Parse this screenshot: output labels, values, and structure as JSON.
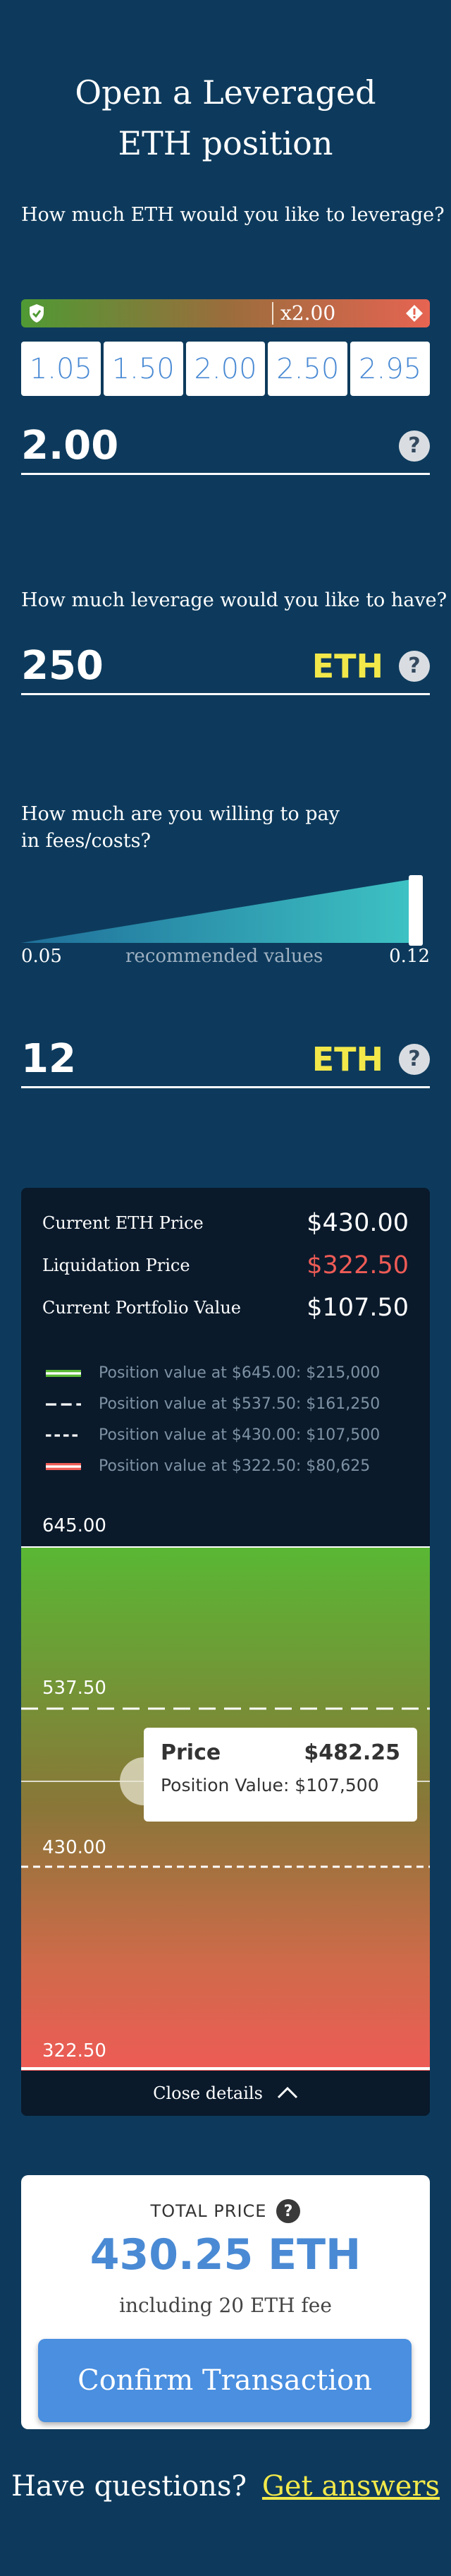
{
  "page": {
    "title_line1": "Open a Leveraged",
    "title_line2": "ETH position"
  },
  "leverage_section": {
    "question": "How much ETH would you like to leverage?",
    "current_multiplier": "x2.00",
    "options": [
      "1.05",
      "1.50",
      "2.00",
      "2.50",
      "2.95"
    ],
    "value": "2.00",
    "help": "?"
  },
  "amount_section": {
    "question": "How much leverage would you like to have?",
    "value": "250",
    "unit": "ETH",
    "help": "?"
  },
  "fees_section": {
    "question_line1": "How much are you willing to pay",
    "question_line2": "in fees/costs?",
    "min_label": "0.05",
    "mid_label": "recommended values",
    "max_label": "0.12",
    "value": "12",
    "unit": "ETH",
    "help": "?"
  },
  "details": {
    "current_eth_price_label": "Current ETH Price",
    "current_eth_price": "$430.00",
    "liquidation_price_label": "Liquidation Price",
    "liquidation_price": "$322.50",
    "portfolio_value_label": "Current Portfolio Value",
    "portfolio_value": "$107.50",
    "legend": [
      "Position value at $645.00: $215,000",
      "Position value at $537.50: $161,250",
      "Position value at $430.00: $107,500",
      "Position value at $322.50: $80,625"
    ],
    "levels": [
      "645.00",
      "537.50",
      "430.00",
      "322.50"
    ],
    "tooltip": {
      "price_label": "Price",
      "price": "$482.25",
      "position_value": "Position Value: $107,500"
    },
    "close_label": "Close details"
  },
  "total": {
    "label": "TOTAL PRICE",
    "help": "?",
    "amount": "430.25 ETH",
    "fee_note": "including 20 ETH fee",
    "confirm_label": "Confirm Transaction"
  },
  "footer": {
    "question": "Have questions?",
    "link": "Get answers"
  },
  "colors": {
    "background": "#0d3a5c",
    "accent_yellow": "#f2e84a",
    "accent_blue": "#4a8ad4",
    "danger": "#ee5b56"
  }
}
